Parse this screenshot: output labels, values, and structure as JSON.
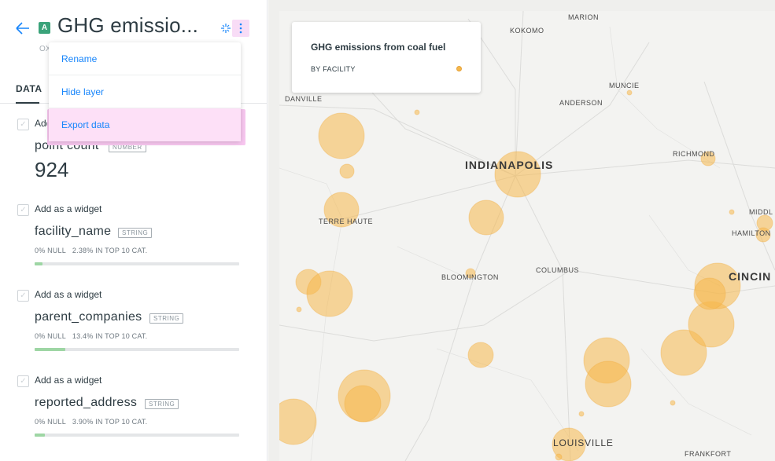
{
  "panel": {
    "layer_badge": "A",
    "layer_title": "GHG emissio...",
    "subtitle_stub": "OX",
    "tab_data": "DATA",
    "fields": [
      {
        "add_label": "Add as a widget",
        "name": "point count",
        "type": "NUMBER",
        "value": "924"
      },
      {
        "add_label": "Add as a widget",
        "name": "facility_name",
        "type": "STRING",
        "null_pct": "0% NULL",
        "top_cat": "2.38% IN TOP 10 CAT.",
        "fill": 0.04
      },
      {
        "add_label": "Add as a widget",
        "name": "parent_companies",
        "type": "STRING",
        "null_pct": "0% NULL",
        "top_cat": "13.4% IN TOP 10 CAT.",
        "fill": 0.15
      },
      {
        "add_label": "Add as a widget",
        "name": "reported_address",
        "type": "STRING",
        "null_pct": "0% NULL",
        "top_cat": "3.90% IN TOP 10 CAT.",
        "fill": 0.05
      }
    ]
  },
  "dropdown": {
    "items": [
      "Rename",
      "Hide layer",
      "Export data"
    ],
    "highlighted": "Export data"
  },
  "legend": {
    "title": "GHG emissions from coal fuel",
    "subtitle": "BY FACILITY",
    "dot_color": "#f5b84c"
  },
  "map": {
    "cities": {
      "marion": "MARION",
      "kokomo": "KOKOMO",
      "muncie": "MUNCIE",
      "anderson": "ANDERSON",
      "danville": "DANVILLE",
      "indianapolis": "INDIANAPOLIS",
      "richmond": "RICHMOND",
      "terre_haute": "TERRE HAUTE",
      "middl": "MIDDL",
      "hamilton": "HAMILTON",
      "bloomington": "BLOOMINGTON",
      "columbus": "COLUMBUS",
      "cincin": "CINCIN",
      "louisville": "LOUISVILLE",
      "frankfort": "FRANKFORT"
    },
    "bubble_color": "#f5b84c"
  }
}
